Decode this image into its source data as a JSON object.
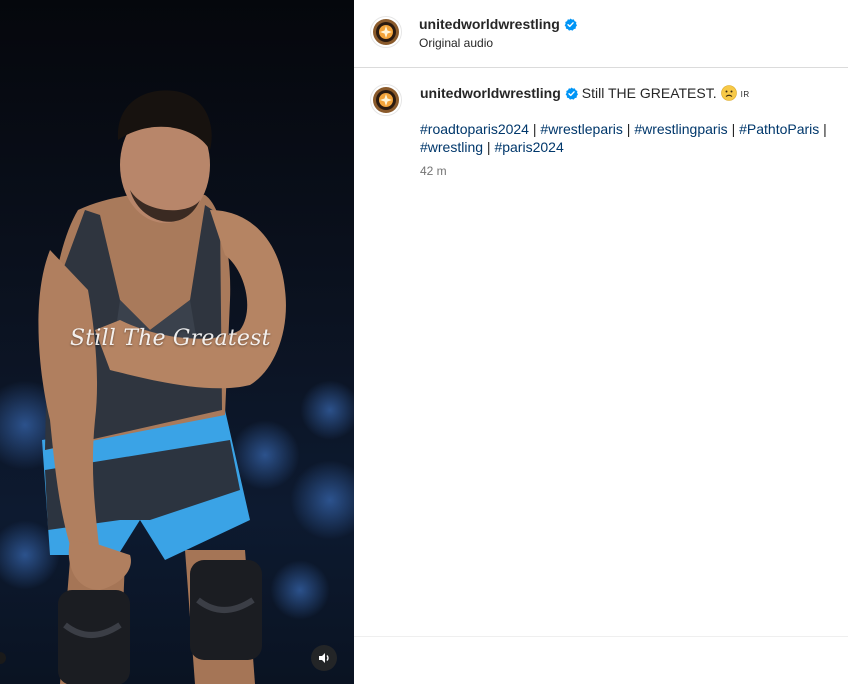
{
  "media": {
    "overlay_text": "Still The Greatest",
    "audio_icon": "speaker-icon"
  },
  "post": {
    "username": "unitedworldwrestling",
    "audio_label": "Original audio",
    "verified_icon": "verified-badge-icon"
  },
  "comment": {
    "username": "unitedworldwrestling",
    "caption": "Still THE GREATEST.",
    "emoji": "worried-face-emoji",
    "flag_text": "IR",
    "hashtags": [
      "#roadtoparis2024",
      "#wrestleparis",
      "#wrestlingparis",
      "#PathtoParis",
      "#wrestling",
      "#paris2024"
    ],
    "separator": "|",
    "time": "42 m"
  },
  "colors": {
    "link": "#00376b",
    "verified": "#0095f6",
    "text": "#262626",
    "muted": "#737373",
    "singlet_blue": "#3aa3e6"
  }
}
